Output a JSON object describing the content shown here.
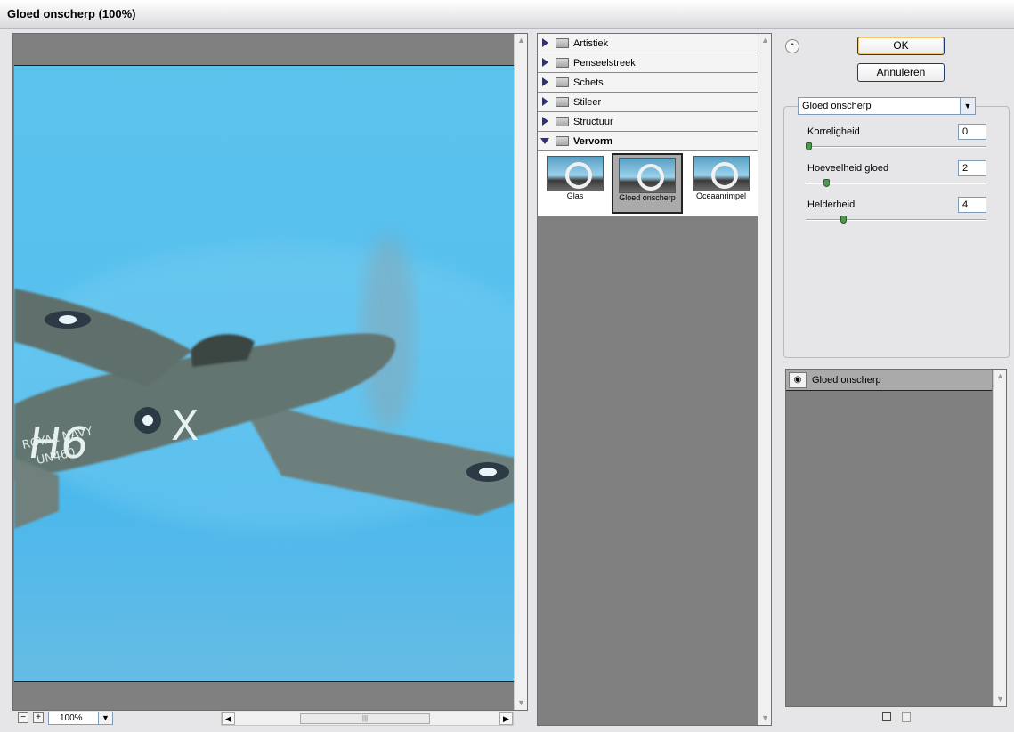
{
  "window": {
    "title": "Gloed onscherp (100%)"
  },
  "preview": {
    "zoom": "100%",
    "scroll_grip": "|||"
  },
  "gallery": {
    "categories": [
      {
        "label": "Artistiek",
        "open": false
      },
      {
        "label": "Penseelstreek",
        "open": false
      },
      {
        "label": "Schets",
        "open": false
      },
      {
        "label": "Stileer",
        "open": false
      },
      {
        "label": "Structuur",
        "open": false
      },
      {
        "label": "Vervorm",
        "open": true
      }
    ],
    "thumbnails": [
      {
        "label": "Glas",
        "selected": false
      },
      {
        "label": "Gloed onscherp",
        "selected": true
      },
      {
        "label": "Oceaanrimpel",
        "selected": false
      }
    ]
  },
  "buttons": {
    "ok": "OK",
    "cancel": "Annuleren"
  },
  "filter": {
    "selected": "Gloed onscherp",
    "params": [
      {
        "label": "Korreligheid",
        "value": "0",
        "slider_pct": 0
      },
      {
        "label": "Hoeveelheid gloed",
        "value": "2",
        "slider_pct": 10
      },
      {
        "label": "Helderheid",
        "value": "4",
        "slider_pct": 20
      }
    ]
  },
  "layers": [
    {
      "name": "Gloed onscherp"
    }
  ],
  "colors": {
    "accent_knob": "#4e9a4a",
    "sky": "#56c0ee"
  }
}
